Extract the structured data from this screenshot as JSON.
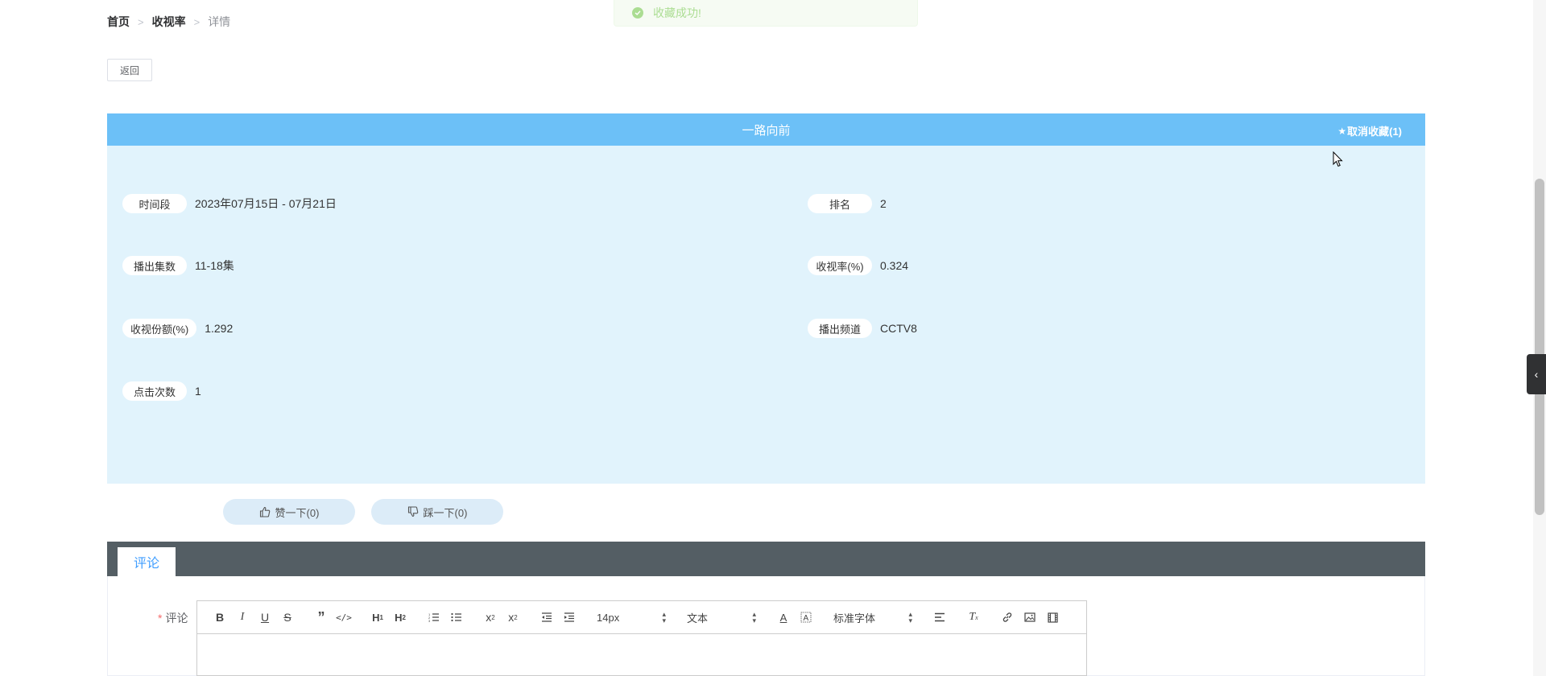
{
  "breadcrumb": {
    "home": "首页",
    "section": "收视率",
    "current": "详情",
    "separator": ">"
  },
  "toast": {
    "message": "收藏成功!",
    "color": "#67c23a"
  },
  "back_button": {
    "label": "返回"
  },
  "detail": {
    "title": "一路向前",
    "favorite_label": "取消收藏(1)",
    "header_color": "#6cc0f7",
    "background_color": "#e1f3fc",
    "fields": {
      "time_period": {
        "label": "时间段",
        "value": "2023年07月15日 - 07月21日"
      },
      "rank": {
        "label": "排名",
        "value": "2"
      },
      "episodes": {
        "label": "播出集数",
        "value": "11-18集"
      },
      "rating": {
        "label": "收视率(%)",
        "value": "0.324"
      },
      "share": {
        "label": "收视份额(%)",
        "value": "1.292"
      },
      "channel": {
        "label": "播出频道",
        "value": "CCTV8"
      },
      "clicks": {
        "label": "点击次数",
        "value": "1"
      }
    }
  },
  "votes": {
    "like_label": "赞一下(0)",
    "dislike_label": "踩一下(0)"
  },
  "comment": {
    "tab_label": "评论",
    "field_label": "评论",
    "required_mark": "*",
    "toolbar": {
      "font_size": "14px",
      "heading_type": "文本",
      "font_family": "标准字体"
    }
  },
  "icons": {
    "star": "star-icon",
    "check": "check-circle-icon",
    "thumbs_up": "thumbs-up-icon",
    "thumbs_down": "thumbs-down-icon",
    "chevron": "chevron-left-icon"
  }
}
